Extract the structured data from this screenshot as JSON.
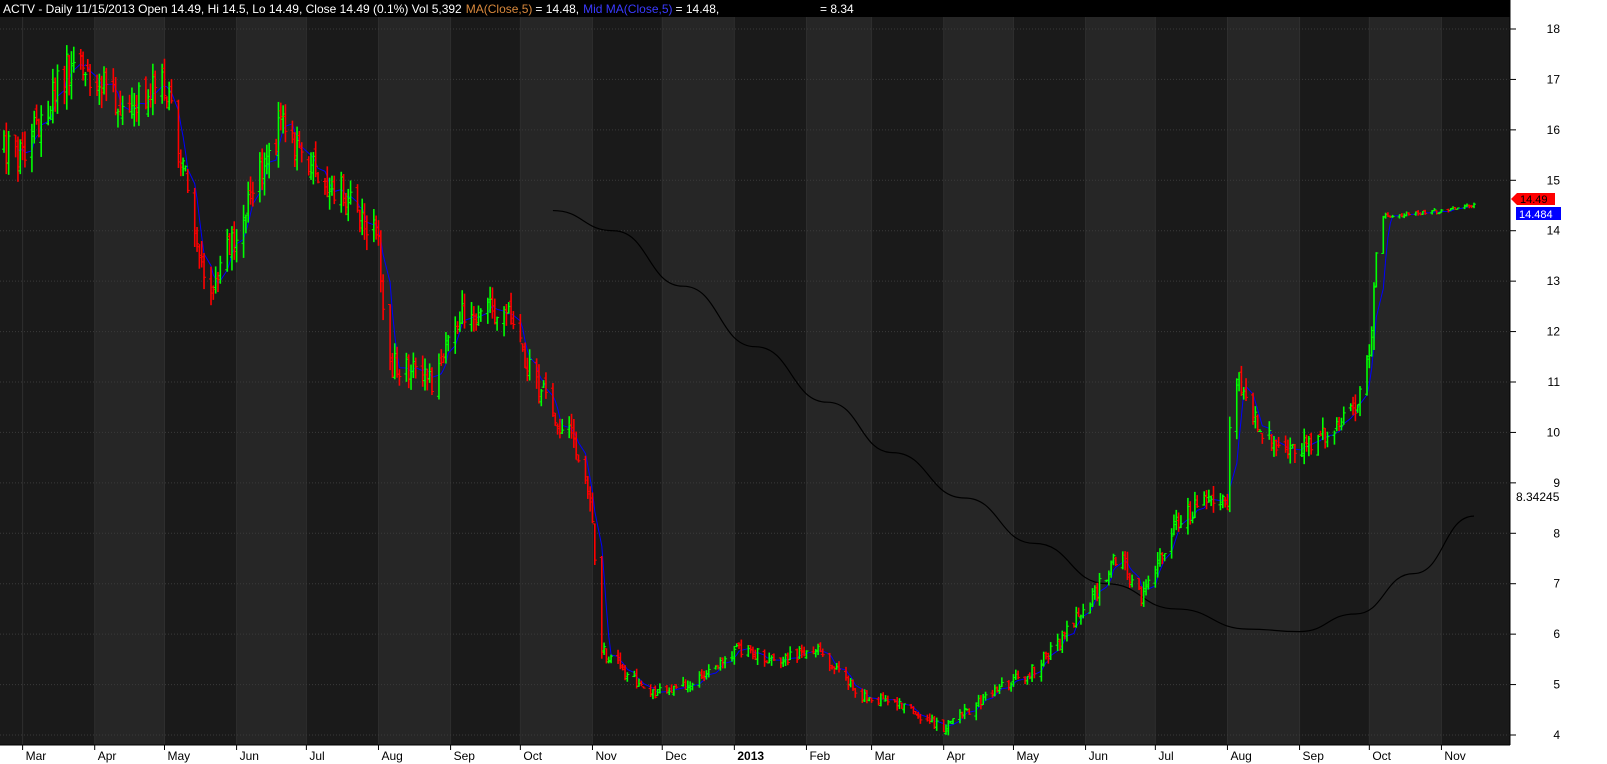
{
  "header": {
    "prefix": "ACTV - Daily 11/15/2013 Open 14.49, Hi 14.5, Lo 14.49, Close 14.49 (0.1%) Vol 5,392",
    "ma_label": "MA(Close,5)",
    "ma_value": "= 14.48,",
    "mid_label": "Mid MA(Close,5)",
    "mid_value": "= 14.48,",
    "extra_value": "= 8.34"
  },
  "price_tags": {
    "close": "14.49",
    "ma": "14.484",
    "slow_ma": "8.34245"
  },
  "colors": {
    "background": "#1a1a1a",
    "band_light": "#262626",
    "up_bar": "#00ff00",
    "down_bar": "#ff0000",
    "ma_line": "#0000ff",
    "slow_line": "#000000",
    "tag_close": "#ff0000",
    "tag_ma": "#0000ff"
  },
  "chart_data": {
    "type": "ohlc",
    "title": "ACTV - Daily",
    "ylim": [
      3.8,
      18.2
    ],
    "y_ticks": [
      4,
      5,
      6,
      7,
      8,
      9,
      10,
      11,
      12,
      13,
      14,
      15,
      16,
      17,
      18
    ],
    "x_tick_labels": [
      "Mar",
      "Apr",
      "May",
      "Jun",
      "Jul",
      "Aug",
      "Sep",
      "Oct",
      "Nov",
      "Dec",
      "2013",
      "Feb",
      "Mar",
      "Apr",
      "May",
      "Jun",
      "Jul",
      "Aug",
      "Sep",
      "Oct",
      "Nov"
    ],
    "close_series": [
      {
        "x": "2012-03-01",
        "y": 15.6
      },
      {
        "x": "2012-03-15",
        "y": 16.8
      },
      {
        "x": "2012-03-25",
        "y": 17.6
      },
      {
        "x": "2012-04-01",
        "y": 16.9
      },
      {
        "x": "2012-04-15",
        "y": 16.5
      },
      {
        "x": "2012-05-01",
        "y": 17.0
      },
      {
        "x": "2012-05-10",
        "y": 15.0
      },
      {
        "x": "2012-05-20",
        "y": 12.9
      },
      {
        "x": "2012-06-01",
        "y": 13.9
      },
      {
        "x": "2012-06-20",
        "y": 16.1
      },
      {
        "x": "2012-07-01",
        "y": 15.3
      },
      {
        "x": "2012-07-20",
        "y": 14.6
      },
      {
        "x": "2012-08-01",
        "y": 13.9
      },
      {
        "x": "2012-08-05",
        "y": 11.4
      },
      {
        "x": "2012-08-25",
        "y": 11.0
      },
      {
        "x": "2012-09-05",
        "y": 12.3
      },
      {
        "x": "2012-09-25",
        "y": 12.4
      },
      {
        "x": "2012-10-10",
        "y": 10.8
      },
      {
        "x": "2012-10-25",
        "y": 9.7
      },
      {
        "x": "2012-10-31",
        "y": 8.7
      },
      {
        "x": "2012-11-05",
        "y": 5.7
      },
      {
        "x": "2012-11-25",
        "y": 4.8
      },
      {
        "x": "2012-12-15",
        "y": 5.0
      },
      {
        "x": "2013-01-01",
        "y": 5.7
      },
      {
        "x": "2013-01-20",
        "y": 5.5
      },
      {
        "x": "2013-02-05",
        "y": 5.7
      },
      {
        "x": "2013-02-25",
        "y": 4.8
      },
      {
        "x": "2013-03-15",
        "y": 4.6
      },
      {
        "x": "2013-04-01",
        "y": 4.1
      },
      {
        "x": "2013-04-20",
        "y": 4.8
      },
      {
        "x": "2013-05-10",
        "y": 5.3
      },
      {
        "x": "2013-05-25",
        "y": 6.1
      },
      {
        "x": "2013-06-05",
        "y": 6.8
      },
      {
        "x": "2013-06-15",
        "y": 7.6
      },
      {
        "x": "2013-06-25",
        "y": 6.7
      },
      {
        "x": "2013-07-10",
        "y": 8.2
      },
      {
        "x": "2013-07-25",
        "y": 8.8
      },
      {
        "x": "2013-08-01",
        "y": 8.6
      },
      {
        "x": "2013-08-03",
        "y": 11.4
      },
      {
        "x": "2013-08-15",
        "y": 10.0
      },
      {
        "x": "2013-08-30",
        "y": 9.6
      },
      {
        "x": "2013-09-10",
        "y": 9.9
      },
      {
        "x": "2013-09-25",
        "y": 10.6
      },
      {
        "x": "2013-10-01",
        "y": 11.4
      },
      {
        "x": "2013-10-05",
        "y": 14.3
      },
      {
        "x": "2013-10-25",
        "y": 14.35
      },
      {
        "x": "2013-11-15",
        "y": 14.49
      }
    ],
    "slow_ma_series": [
      {
        "x": "2012-10-15",
        "y": 14.4
      },
      {
        "x": "2012-11-10",
        "y": 14.0
      },
      {
        "x": "2012-12-10",
        "y": 12.9
      },
      {
        "x": "2013-01-10",
        "y": 11.7
      },
      {
        "x": "2013-02-10",
        "y": 10.6
      },
      {
        "x": "2013-03-10",
        "y": 9.6
      },
      {
        "x": "2013-04-10",
        "y": 8.7
      },
      {
        "x": "2013-05-10",
        "y": 7.8
      },
      {
        "x": "2013-06-10",
        "y": 7.0
      },
      {
        "x": "2013-07-10",
        "y": 6.5
      },
      {
        "x": "2013-08-10",
        "y": 6.1
      },
      {
        "x": "2013-09-01",
        "y": 6.05
      },
      {
        "x": "2013-09-25",
        "y": 6.4
      },
      {
        "x": "2013-10-20",
        "y": 7.2
      },
      {
        "x": "2013-11-15",
        "y": 8.34
      }
    ]
  }
}
